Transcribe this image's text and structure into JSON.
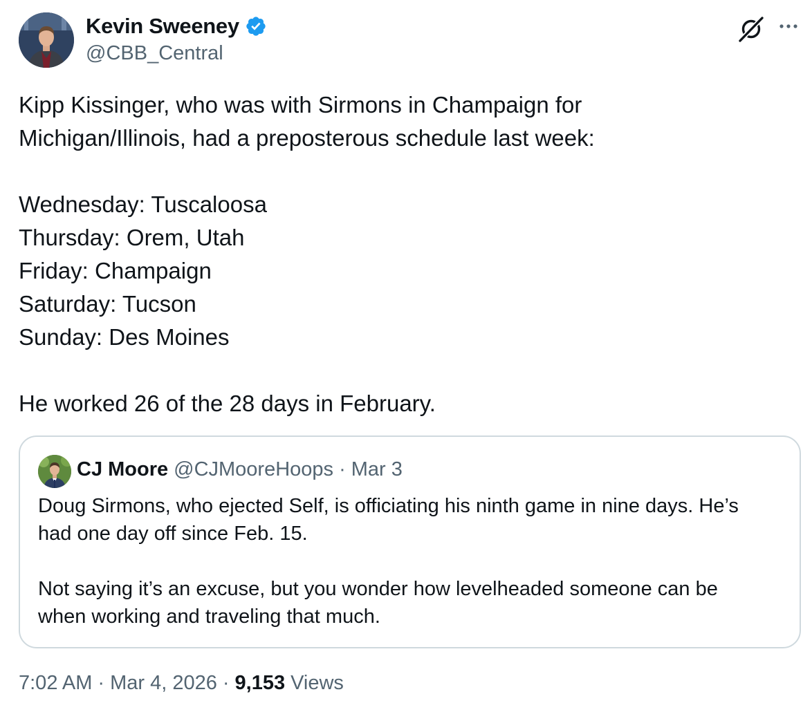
{
  "author": {
    "name": "Kevin Sweeney",
    "handle": "@CBB_Central",
    "verified_color": "#1d9bf0"
  },
  "actions": {
    "grok_icon": "grok-icon",
    "more_icon": "more-icon"
  },
  "tweet": {
    "intro_line1": "Kipp Kissinger, who was with Sirmons in Champaign for",
    "intro_line2": "Michigan/Illinois, had a preposterous schedule last week:",
    "schedule": [
      "Wednesday: Tuscaloosa",
      "Thursday: Orem, Utah",
      "Friday: Champaign",
      "Saturday: Tucson",
      "Sunday: Des Moines"
    ],
    "closing": "He worked 26 of the 28 days in February."
  },
  "quote": {
    "name": "CJ Moore",
    "handle": "@CJMooreHoops",
    "separator": "·",
    "date": "Mar 3",
    "para1_line1": "Doug Sirmons, who ejected Self, is officiating his ninth game in nine days. He’s",
    "para1_line2": "had one day off since Feb. 15.",
    "para2_line1": "Not saying it’s an excuse, but you wonder how levelheaded someone can be",
    "para2_line2": "when working and traveling that much."
  },
  "meta": {
    "time": "7:02 AM",
    "sep1": "·",
    "date": "Mar 4, 2026",
    "sep2": "·",
    "views_count": "9,153",
    "views_label": "Views"
  }
}
